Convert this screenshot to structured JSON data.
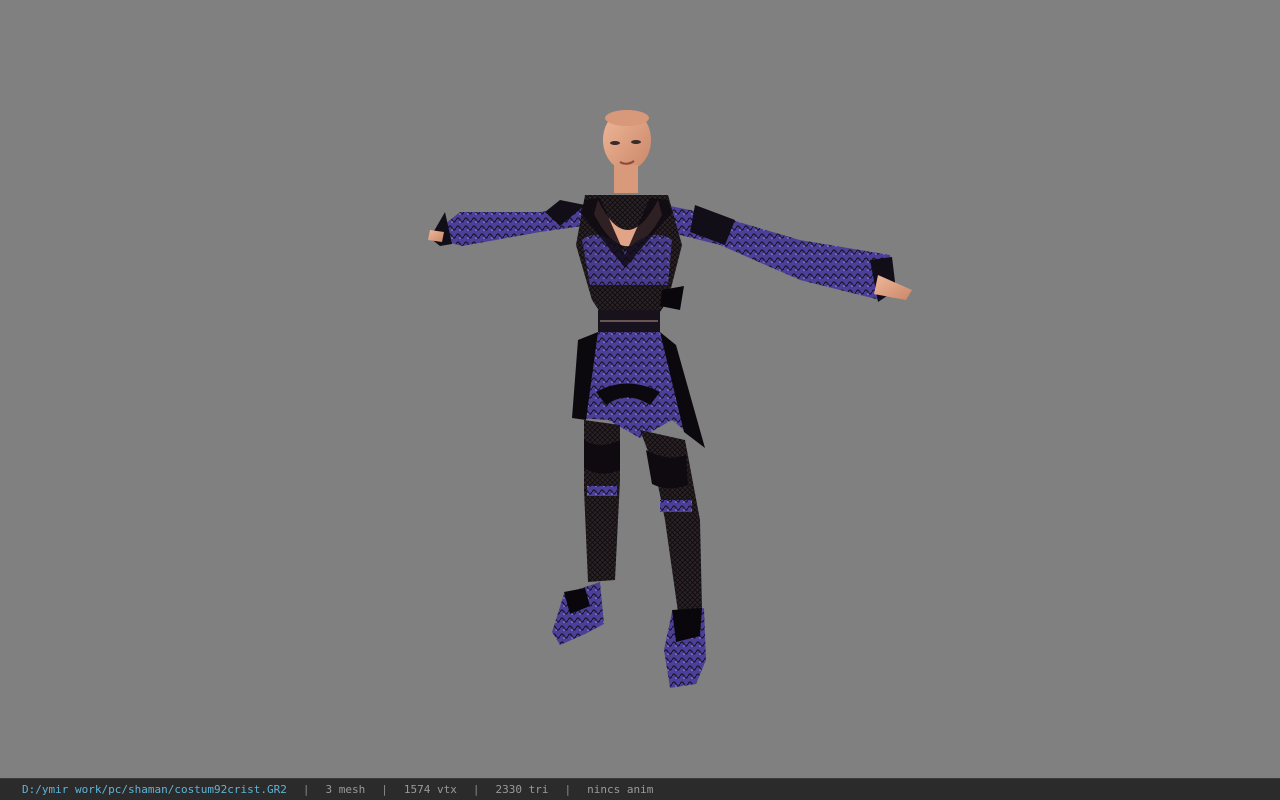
{
  "viewer": {
    "background_color": "#808080",
    "model_name": "costum92crist"
  },
  "status_bar": {
    "file_path": "D:/ymir work/pc/shaman/costum92crist.GR2",
    "separator": "|",
    "mesh_count": "3 mesh",
    "vertex_count": "1574 vtx",
    "triangle_count": "2330 tri",
    "anim_status": "nincs anim"
  },
  "colors": {
    "path_text": "#5fb3d8",
    "status_text": "#9a9a9a",
    "status_bg": "#2b2b2b",
    "skin": "#e3a88a",
    "outfit_purple": "#5b4fa8",
    "outfit_black": "#141018"
  }
}
